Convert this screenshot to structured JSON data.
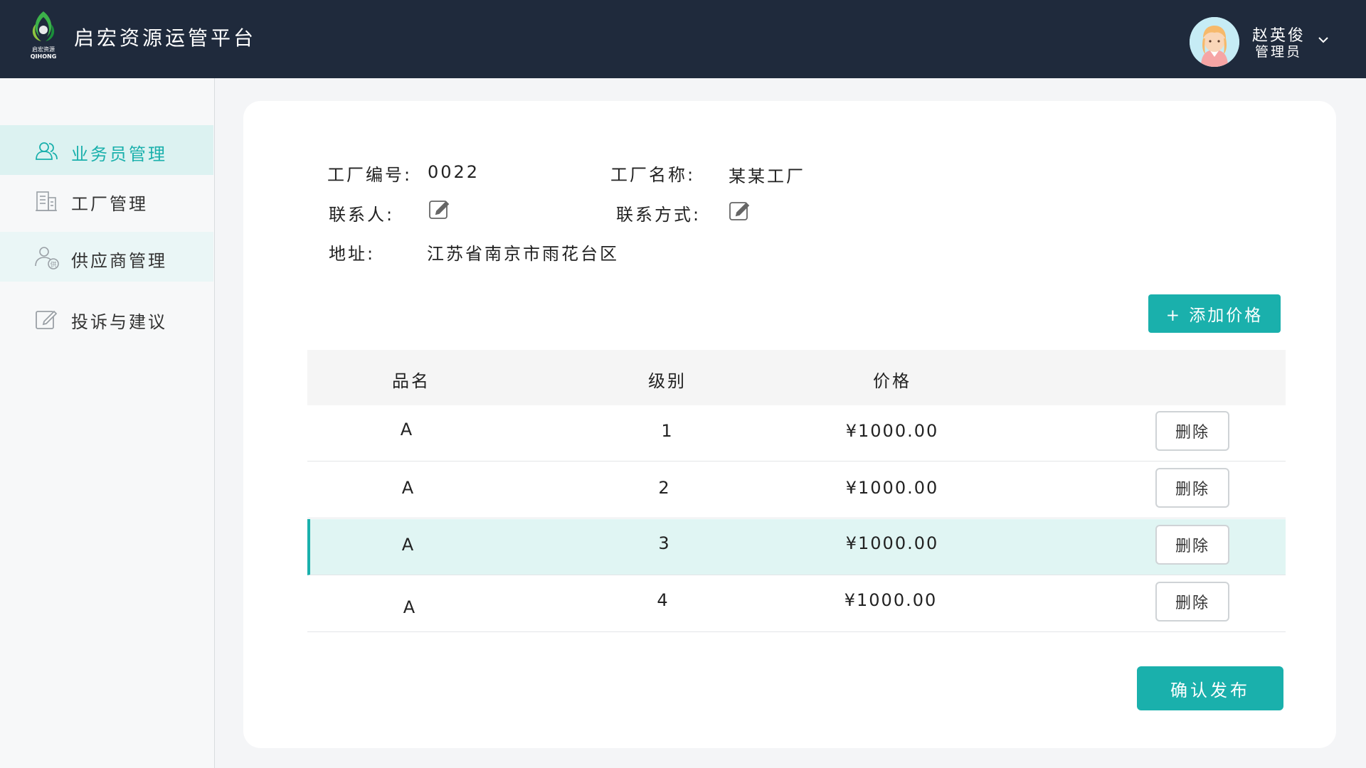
{
  "header": {
    "app_title": "启宏资源运管平台",
    "logo_text_top": "启宏资源",
    "logo_text_bottom": "QIHONG",
    "user_name": "赵英俊",
    "user_role": "管理员"
  },
  "sidebar": {
    "items": [
      {
        "label": "业务员管理",
        "icon": "user-group-icon",
        "active": true
      },
      {
        "label": "工厂管理",
        "icon": "building-icon",
        "active": false
      },
      {
        "label": "供应商管理",
        "icon": "supplier-icon",
        "active": false
      },
      {
        "label": "投诉与建议",
        "icon": "edit-note-icon",
        "active": false
      }
    ]
  },
  "factory": {
    "id_label": "工厂编号:",
    "id_value": "0022",
    "name_label": "工厂名称:",
    "name_value": "某某工厂",
    "contact_label": "联系人:",
    "contact_method_label": "联系方式:",
    "address_label": "地址:",
    "address_value": "江苏省南京市雨花台区"
  },
  "actions": {
    "add_price": "+ 添加价格",
    "confirm_publish": "确认发布"
  },
  "table": {
    "headers": [
      "品名",
      "级别",
      "价格"
    ],
    "rows": [
      {
        "name": "A",
        "level": "1",
        "price": "¥1000.00",
        "delete": "删除"
      },
      {
        "name": "A",
        "level": "2",
        "price": "¥1000.00",
        "delete": "删除"
      },
      {
        "name": "A",
        "level": "3",
        "price": "¥1000.00",
        "delete": "删除",
        "highlighted": true
      },
      {
        "name": "A",
        "level": "4",
        "price": "¥1000.00",
        "delete": "删除"
      }
    ]
  },
  "colors": {
    "header_bg": "#1f2a3c",
    "accent": "#1ab0ac",
    "highlight_row": "#e0f5f3",
    "active_nav": "#dcf2f1"
  }
}
